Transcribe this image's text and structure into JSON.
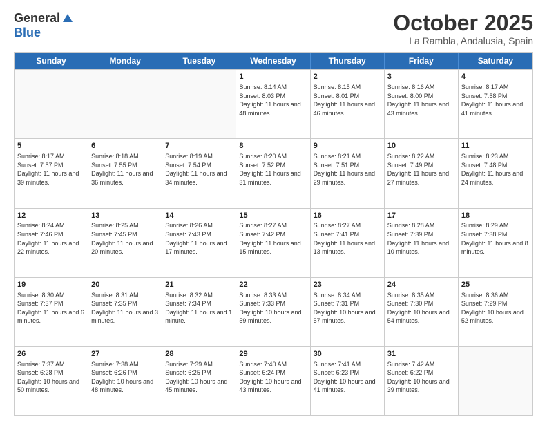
{
  "logo": {
    "general": "General",
    "blue": "Blue"
  },
  "title": "October 2025",
  "location": "La Rambla, Andalusia, Spain",
  "headers": [
    "Sunday",
    "Monday",
    "Tuesday",
    "Wednesday",
    "Thursday",
    "Friday",
    "Saturday"
  ],
  "rows": [
    [
      {
        "day": "",
        "text": "",
        "empty": true
      },
      {
        "day": "",
        "text": "",
        "empty": true
      },
      {
        "day": "",
        "text": "",
        "empty": true
      },
      {
        "day": "1",
        "text": "Sunrise: 8:14 AM\nSunset: 8:03 PM\nDaylight: 11 hours\nand 48 minutes."
      },
      {
        "day": "2",
        "text": "Sunrise: 8:15 AM\nSunset: 8:01 PM\nDaylight: 11 hours\nand 46 minutes."
      },
      {
        "day": "3",
        "text": "Sunrise: 8:16 AM\nSunset: 8:00 PM\nDaylight: 11 hours\nand 43 minutes."
      },
      {
        "day": "4",
        "text": "Sunrise: 8:17 AM\nSunset: 7:58 PM\nDaylight: 11 hours\nand 41 minutes."
      }
    ],
    [
      {
        "day": "5",
        "text": "Sunrise: 8:17 AM\nSunset: 7:57 PM\nDaylight: 11 hours\nand 39 minutes."
      },
      {
        "day": "6",
        "text": "Sunrise: 8:18 AM\nSunset: 7:55 PM\nDaylight: 11 hours\nand 36 minutes."
      },
      {
        "day": "7",
        "text": "Sunrise: 8:19 AM\nSunset: 7:54 PM\nDaylight: 11 hours\nand 34 minutes."
      },
      {
        "day": "8",
        "text": "Sunrise: 8:20 AM\nSunset: 7:52 PM\nDaylight: 11 hours\nand 31 minutes."
      },
      {
        "day": "9",
        "text": "Sunrise: 8:21 AM\nSunset: 7:51 PM\nDaylight: 11 hours\nand 29 minutes."
      },
      {
        "day": "10",
        "text": "Sunrise: 8:22 AM\nSunset: 7:49 PM\nDaylight: 11 hours\nand 27 minutes."
      },
      {
        "day": "11",
        "text": "Sunrise: 8:23 AM\nSunset: 7:48 PM\nDaylight: 11 hours\nand 24 minutes."
      }
    ],
    [
      {
        "day": "12",
        "text": "Sunrise: 8:24 AM\nSunset: 7:46 PM\nDaylight: 11 hours\nand 22 minutes."
      },
      {
        "day": "13",
        "text": "Sunrise: 8:25 AM\nSunset: 7:45 PM\nDaylight: 11 hours\nand 20 minutes."
      },
      {
        "day": "14",
        "text": "Sunrise: 8:26 AM\nSunset: 7:43 PM\nDaylight: 11 hours\nand 17 minutes."
      },
      {
        "day": "15",
        "text": "Sunrise: 8:27 AM\nSunset: 7:42 PM\nDaylight: 11 hours\nand 15 minutes."
      },
      {
        "day": "16",
        "text": "Sunrise: 8:27 AM\nSunset: 7:41 PM\nDaylight: 11 hours\nand 13 minutes."
      },
      {
        "day": "17",
        "text": "Sunrise: 8:28 AM\nSunset: 7:39 PM\nDaylight: 11 hours\nand 10 minutes."
      },
      {
        "day": "18",
        "text": "Sunrise: 8:29 AM\nSunset: 7:38 PM\nDaylight: 11 hours\nand 8 minutes."
      }
    ],
    [
      {
        "day": "19",
        "text": "Sunrise: 8:30 AM\nSunset: 7:37 PM\nDaylight: 11 hours\nand 6 minutes."
      },
      {
        "day": "20",
        "text": "Sunrise: 8:31 AM\nSunset: 7:35 PM\nDaylight: 11 hours\nand 3 minutes."
      },
      {
        "day": "21",
        "text": "Sunrise: 8:32 AM\nSunset: 7:34 PM\nDaylight: 11 hours\nand 1 minute."
      },
      {
        "day": "22",
        "text": "Sunrise: 8:33 AM\nSunset: 7:33 PM\nDaylight: 10 hours\nand 59 minutes."
      },
      {
        "day": "23",
        "text": "Sunrise: 8:34 AM\nSunset: 7:31 PM\nDaylight: 10 hours\nand 57 minutes."
      },
      {
        "day": "24",
        "text": "Sunrise: 8:35 AM\nSunset: 7:30 PM\nDaylight: 10 hours\nand 54 minutes."
      },
      {
        "day": "25",
        "text": "Sunrise: 8:36 AM\nSunset: 7:29 PM\nDaylight: 10 hours\nand 52 minutes."
      }
    ],
    [
      {
        "day": "26",
        "text": "Sunrise: 7:37 AM\nSunset: 6:28 PM\nDaylight: 10 hours\nand 50 minutes."
      },
      {
        "day": "27",
        "text": "Sunrise: 7:38 AM\nSunset: 6:26 PM\nDaylight: 10 hours\nand 48 minutes."
      },
      {
        "day": "28",
        "text": "Sunrise: 7:39 AM\nSunset: 6:25 PM\nDaylight: 10 hours\nand 45 minutes."
      },
      {
        "day": "29",
        "text": "Sunrise: 7:40 AM\nSunset: 6:24 PM\nDaylight: 10 hours\nand 43 minutes."
      },
      {
        "day": "30",
        "text": "Sunrise: 7:41 AM\nSunset: 6:23 PM\nDaylight: 10 hours\nand 41 minutes."
      },
      {
        "day": "31",
        "text": "Sunrise: 7:42 AM\nSunset: 6:22 PM\nDaylight: 10 hours\nand 39 minutes."
      },
      {
        "day": "",
        "text": "",
        "empty": true
      }
    ]
  ]
}
